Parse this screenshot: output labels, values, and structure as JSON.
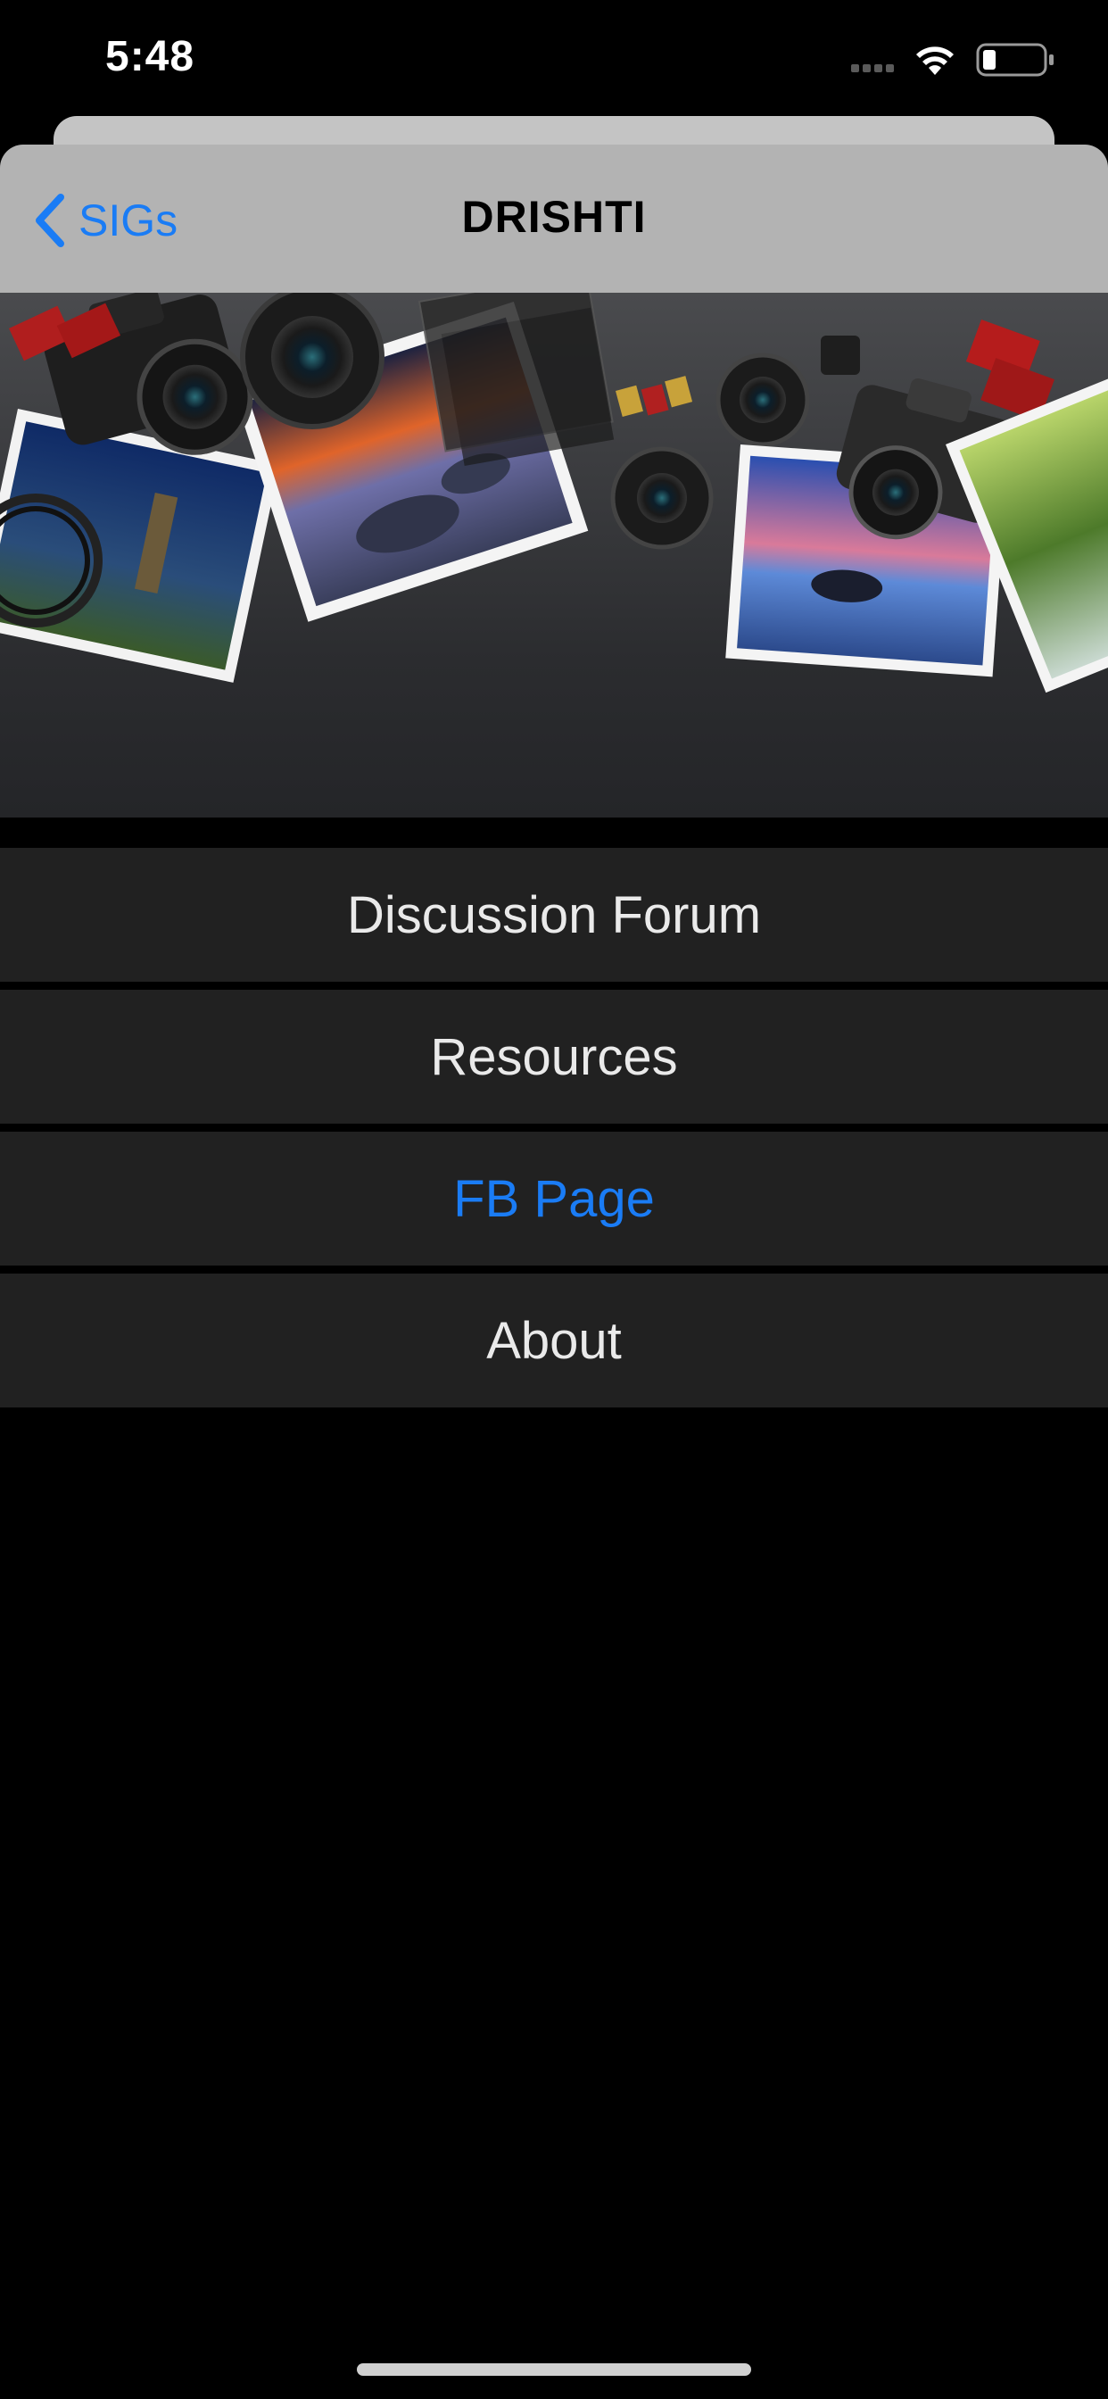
{
  "status_bar": {
    "time": "5:48",
    "icons": [
      "signal-icon",
      "wifi-icon",
      "battery-icon"
    ]
  },
  "nav": {
    "back_label": "SIGs",
    "title": "DRISHTI"
  },
  "hero_image": {
    "description": "photography-equipment-banner"
  },
  "menu": {
    "items": [
      {
        "label": "Discussion Forum"
      },
      {
        "label": "Resources"
      },
      {
        "label": "FB Page"
      },
      {
        "label": "About"
      }
    ]
  },
  "colors": {
    "accent": "#1a7cf5",
    "nav_bg": "#b3b3b3",
    "row_bg": "#212121",
    "background": "#000000"
  }
}
